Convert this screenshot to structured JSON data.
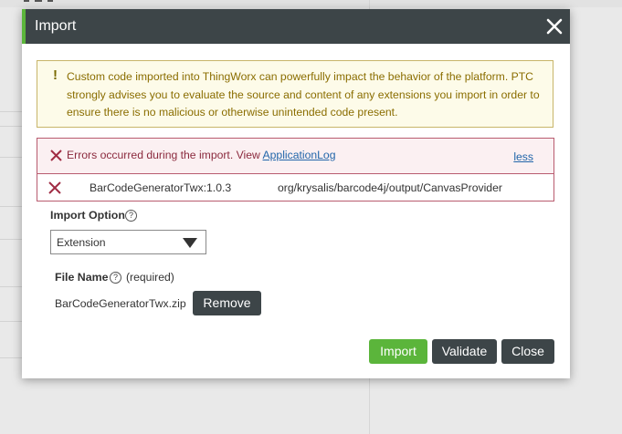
{
  "dialog": {
    "title": "Import",
    "warning": {
      "mark": "!",
      "text": "Custom code imported into ThingWorx can powerfully impact the behavior of the platform. PTC strongly advises you to evaluate the source and content of any extensions you import in order to ensure there is no malicious or otherwise unintended code present."
    },
    "error": {
      "message": "Errors occurred during the import. View",
      "link": "ApplicationLog",
      "toggle": "less",
      "rows": [
        {
          "name": "BarCodeGeneratorTwx:1.0.3",
          "path": "org/krysalis/barcode4j/output/CanvasProvider"
        }
      ]
    },
    "import_option": {
      "label": "Import Option",
      "help": "?",
      "selected": "Extension"
    },
    "file": {
      "label": "File Name",
      "help": "?",
      "required": "(required)",
      "filename": "BarCodeGeneratorTwx.zip",
      "remove_label": "Remove"
    },
    "buttons": {
      "import": "Import",
      "validate": "Validate",
      "close": "Close"
    }
  },
  "colors": {
    "accent": "#5bb53b",
    "titlebar": "#3d4548",
    "warning_text": "#8a6d00",
    "error_text": "#8b2a3e",
    "error_border": "#b85b6f",
    "link": "#2266aa"
  },
  "icons": [
    "close-icon",
    "error-icon",
    "help-icon",
    "chevron-down-icon"
  ]
}
